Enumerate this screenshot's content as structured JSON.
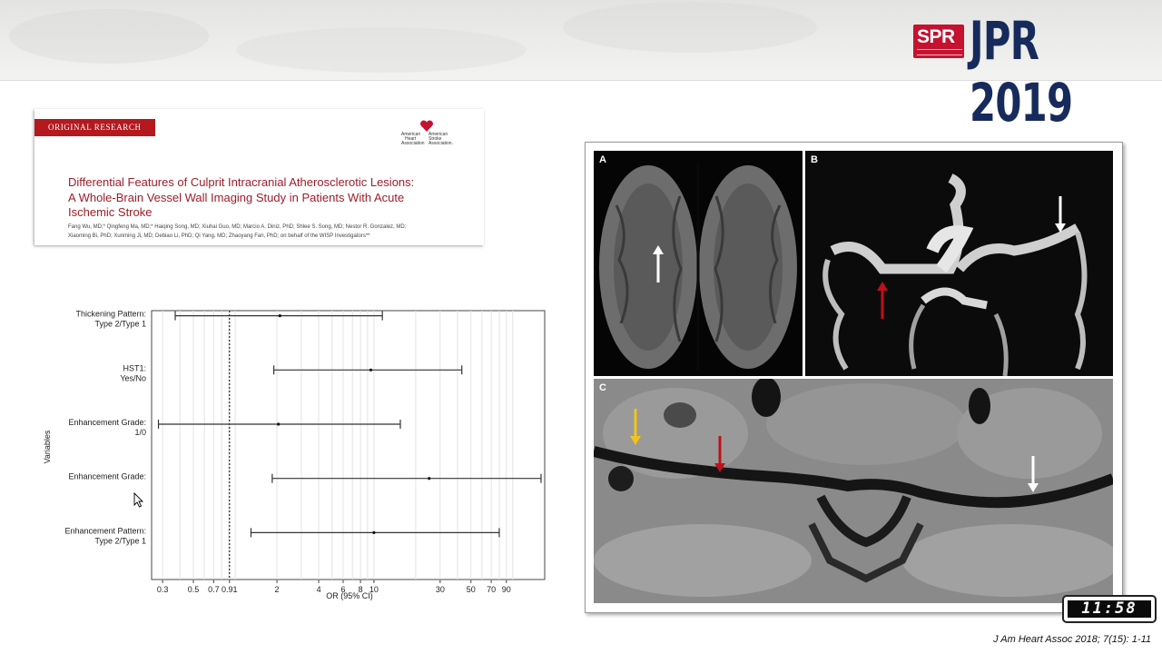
{
  "header": {
    "spr_logo_text": "SPR",
    "conference_title": "JPR 2019"
  },
  "paper": {
    "section_tag": "ORIGINAL RESEARCH",
    "publisher_logo_words": [
      "American",
      "Heart",
      "Association",
      "American",
      "Stroke",
      "Association."
    ],
    "title_lines": [
      "Differential Features of Culprit Intracranial Atherosclerotic Lesions:",
      "A Whole-Brain Vessel Wall Imaging Study in Patients With Acute",
      "Ischemic Stroke"
    ],
    "authors_lines": [
      "Fang Wu, MD;* Qingfeng Ma, MD;* Haiqing Song, MD; Xiuhai Guo, MD; Marcio A. Diniz, PhD; Shlee S. Song, MD; Nestor R. Gonzalez, MD;",
      "Xiaoming Bi, PhD; Xunming Ji, MD; Debiao Li, PhD; Qi Yang, MD; Zhaoyang Fan, PhD; on behalf of the WISP Investigators**"
    ]
  },
  "chart_data": {
    "type": "forest",
    "xscale": "log",
    "xlabel": "OR (95% CI)",
    "ylabel": "Variables",
    "xlim": [
      0.25,
      170
    ],
    "reference_line": 0.91,
    "xticks": [
      0.3,
      0.5,
      0.7,
      0.91,
      2,
      4,
      6,
      8,
      10,
      30,
      50,
      70,
      90
    ],
    "tick_labels": [
      "0.3",
      "0.5",
      "0.7",
      "0.91",
      "2",
      "4",
      "6",
      "8",
      "10",
      "30",
      "50",
      "70",
      "90"
    ],
    "grid": true,
    "rows": [
      {
        "label": [
          "Thickening Pattern:",
          "Type 2/Type 1"
        ],
        "or": 2.1,
        "lo": 0.37,
        "hi": 11.5
      },
      {
        "label": [
          "HST1:",
          "Yes/No"
        ],
        "or": 9.5,
        "lo": 1.9,
        "hi": 43
      },
      {
        "label": [
          "Enhancement Grade:",
          "1/0"
        ],
        "or": 2.05,
        "lo": 0.28,
        "hi": 15.5
      },
      {
        "label": [
          "Enhancement Grade:"
        ],
        "or": 25,
        "lo": 1.85,
        "hi": 160
      },
      {
        "label": [
          "Enhancement Pattern:",
          "Type 2/Type 1"
        ],
        "or": 10,
        "lo": 1.3,
        "hi": 80
      }
    ]
  },
  "figure": {
    "panel_labels": [
      "A",
      "B",
      "C"
    ]
  },
  "timer": "11:58",
  "citation": "J Am Heart Assoc 2018; 7(15): 1-11"
}
